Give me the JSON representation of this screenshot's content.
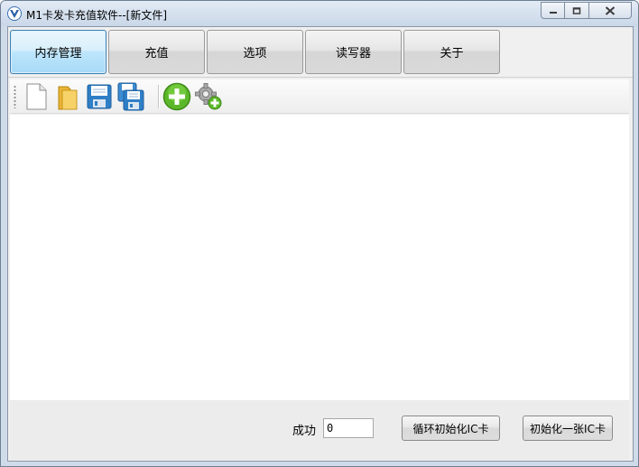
{
  "window": {
    "title": "M1卡发卡充值软件--[新文件]"
  },
  "tabs": [
    {
      "label": "内存管理",
      "active": true
    },
    {
      "label": "充值",
      "active": false
    },
    {
      "label": "选项",
      "active": false
    },
    {
      "label": "读写器",
      "active": false
    },
    {
      "label": "关于",
      "active": false
    }
  ],
  "toolbar": {
    "icons": [
      "new-file-icon",
      "open-folder-icon",
      "save-icon",
      "save-all-icon",
      "add-icon",
      "settings-add-icon"
    ]
  },
  "bottom": {
    "success_label": "成功",
    "success_value": "0",
    "loop_init_button": "循环初始化IC卡",
    "init_one_button": "初始化一张IC卡"
  },
  "colors": {
    "active_tab": "#bee6fd",
    "add_green": "#5cb82a",
    "folder_yellow": "#f3c94a",
    "disk_blue": "#2f7fc7"
  }
}
